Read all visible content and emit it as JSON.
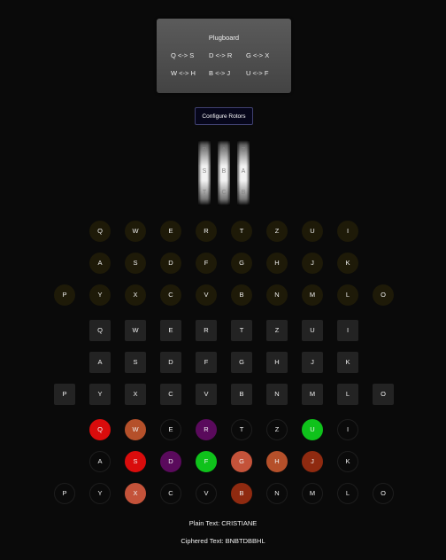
{
  "plugboard": {
    "title": "Plugboard",
    "pairs": [
      "Q <-> S",
      "D <-> R",
      "G <-> X",
      "W <-> H",
      "B <-> J",
      "U <-> F"
    ]
  },
  "configure_button": "Configure Rotors",
  "rotors": [
    {
      "letters": [
        "R",
        "S",
        "T"
      ]
    },
    {
      "letters": [
        "A",
        "B",
        "C"
      ]
    },
    {
      "letters": [
        "Z",
        "A",
        "B"
      ]
    }
  ],
  "lampboard": {
    "rows": [
      [
        "Q",
        "W",
        "E",
        "R",
        "T",
        "Z",
        "U",
        "I"
      ],
      [
        "A",
        "S",
        "D",
        "F",
        "G",
        "H",
        "J",
        "K"
      ],
      [
        "P",
        "Y",
        "X",
        "C",
        "V",
        "B",
        "N",
        "M",
        "L",
        "O"
      ]
    ]
  },
  "keyboard": {
    "rows": [
      [
        "Q",
        "W",
        "E",
        "R",
        "T",
        "Z",
        "U",
        "I"
      ],
      [
        "A",
        "S",
        "D",
        "F",
        "G",
        "H",
        "J",
        "K"
      ],
      [
        "P",
        "Y",
        "X",
        "C",
        "V",
        "B",
        "N",
        "M",
        "L",
        "O"
      ]
    ]
  },
  "plug_lights": {
    "rows": [
      [
        "Q",
        "W",
        "E",
        "R",
        "T",
        "Z",
        "U",
        "I"
      ],
      [
        "A",
        "S",
        "D",
        "F",
        "G",
        "H",
        "J",
        "K"
      ],
      [
        "P",
        "Y",
        "X",
        "C",
        "V",
        "B",
        "N",
        "M",
        "L",
        "O"
      ]
    ],
    "colors": {
      "Q": "#d90c0c",
      "W": "#b5502a",
      "R": "#5a0a5c",
      "U": "#0fc21b",
      "S": "#d90c0c",
      "D": "#5a0a5c",
      "F": "#0fc21b",
      "G": "#c4533a",
      "H": "#b5502a",
      "J": "#8f2a10",
      "X": "#c4533a",
      "B": "#8f2a10"
    }
  },
  "plain_text": "Plain Text: CRISTIANE",
  "ciphered_text": "Ciphered Text: BNBTDBBHL"
}
